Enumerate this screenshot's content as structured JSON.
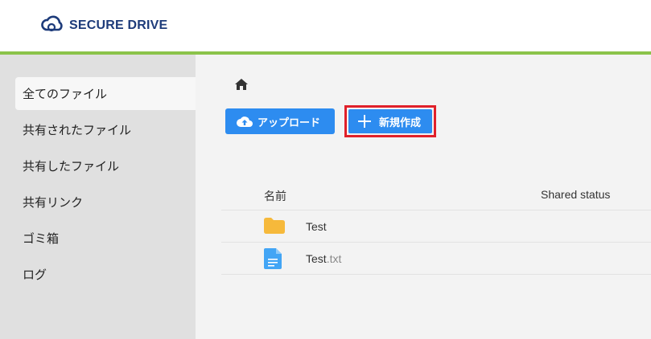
{
  "header": {
    "brand": "SECURE DRIVE",
    "colors": {
      "brand": "#1d3b7a",
      "accent_bar": "#8bc34a"
    }
  },
  "sidebar": {
    "items": [
      {
        "label": "全てのファイル",
        "active": true
      },
      {
        "label": "共有されたファイル"
      },
      {
        "label": "共有したファイル"
      },
      {
        "label": "共有リンク"
      },
      {
        "label": "ゴミ箱"
      },
      {
        "label": "ログ"
      }
    ]
  },
  "toolbar": {
    "upload_label": "アップロード",
    "new_label": "新規作成",
    "button_color": "#2d8cf0",
    "highlight_color": "#e0202a"
  },
  "table": {
    "columns": {
      "name": "名前",
      "shared_status": "Shared status"
    },
    "rows": [
      {
        "type": "folder",
        "name": "Test",
        "ext": ""
      },
      {
        "type": "file",
        "name": "Test",
        "ext": ".txt"
      }
    ]
  },
  "icons": {
    "logo": "cloud-logo-icon",
    "home": "home-icon",
    "upload": "cloud-upload-icon",
    "new": "plus-icon",
    "folder": "folder-icon",
    "file": "document-icon"
  }
}
